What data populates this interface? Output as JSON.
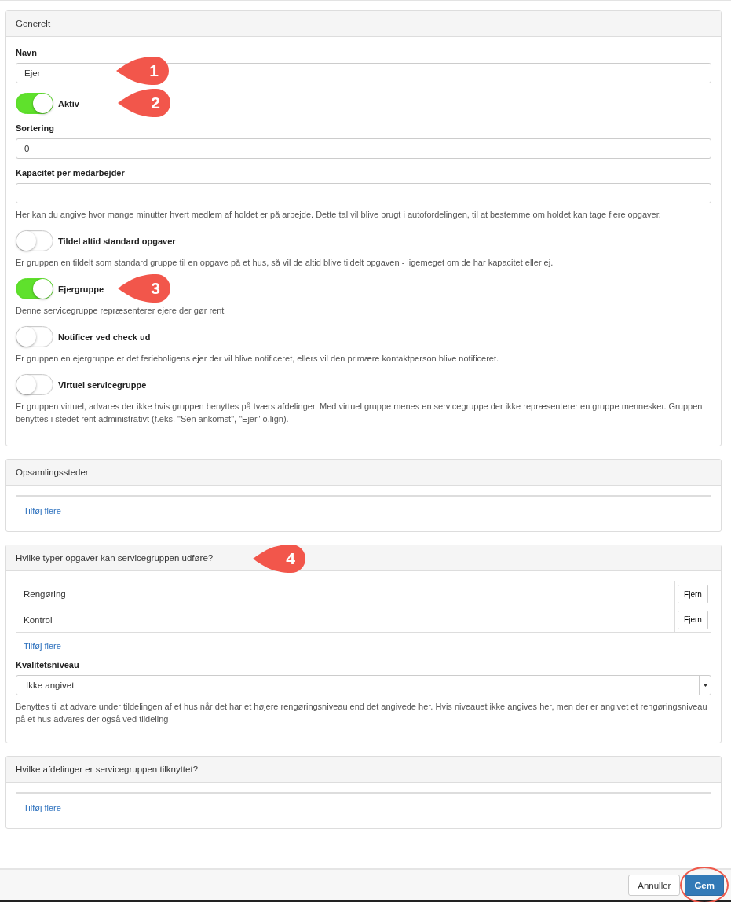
{
  "panels": [
    {
      "title": "Generelt",
      "kind": "general",
      "fields": [
        {
          "kind": "text",
          "label": "Navn",
          "value": "Ejer",
          "callout": "1"
        },
        {
          "kind": "toggle",
          "label": "Aktiv",
          "on": true,
          "callout": "2"
        },
        {
          "kind": "text",
          "label": "Sortering",
          "value": "0"
        },
        {
          "kind": "text",
          "label": "Kapacitet per medarbejder",
          "help": "Her kan du angive hvor mange minutter hvert medlem af holdet er på arbejde. Dette tal vil blive brugt i autofordelingen, til at bestemme om holdet kan tage flere opgaver."
        },
        {
          "kind": "toggle",
          "label": "Tildel altid standard opgaver",
          "on": false,
          "help": "Er gruppen en tildelt som standard gruppe til en opgave på et hus, så vil de altid blive tildelt opgaven - ligemeget om de har kapacitet eller ej."
        },
        {
          "kind": "toggle",
          "label": "Ejergruppe",
          "on": true,
          "callout": "3",
          "help": "Denne servicegruppe repræsenterer ejere der gør rent"
        },
        {
          "kind": "toggle",
          "label": "Notificer ved check ud",
          "on": false,
          "help": "Er gruppen en ejergruppe er det ferieboligens ejer der vil blive notificeret, ellers vil den primære kontaktperson blive notificeret."
        },
        {
          "kind": "toggle",
          "label": "Virtuel servicegruppe",
          "on": false,
          "help": "Er gruppen virtuel, advares der ikke hvis gruppen benyttes på tværs afdelinger. Med virtuel gruppe menes en servicegruppe der ikke repræsenterer en gruppe mennesker. Gruppen benyttes i stedet rent administrativt (f.eks. \"Sen ankomst\", \"Ejer\" o.lign)."
        }
      ]
    },
    {
      "title": "Opsamlingssteder",
      "kind": "list",
      "add_link": "Tilføj flere"
    },
    {
      "title": "Hvilke typer opgaver kan servicegruppen udføre?",
      "kind": "tasks",
      "callout": "4",
      "rows": [
        {
          "name": "Rengøring",
          "button": "Fjern"
        },
        {
          "name": "Kontrol",
          "button": "Fjern"
        }
      ],
      "add_link": "Tilføj flere",
      "select": {
        "label": "Kvalitetsniveau",
        "value": "Ikke angivet",
        "help": "Benyttes til at advare under tildelingen af et hus når det har et højere rengøringsniveau end det angivede her. Hvis niveauet ikke angives her, men der er angivet et rengøringsniveau på et hus advares der også ved tildeling"
      }
    },
    {
      "title": "Hvilke afdelinger er servicegruppen tilknyttet?",
      "kind": "list",
      "add_link": "Tilføj flere"
    }
  ],
  "footer": {
    "buttons": [
      {
        "label": "Annuller",
        "kind": "default",
        "highlighted": false
      },
      {
        "label": "Gem",
        "kind": "primary",
        "highlighted": true
      }
    ]
  }
}
